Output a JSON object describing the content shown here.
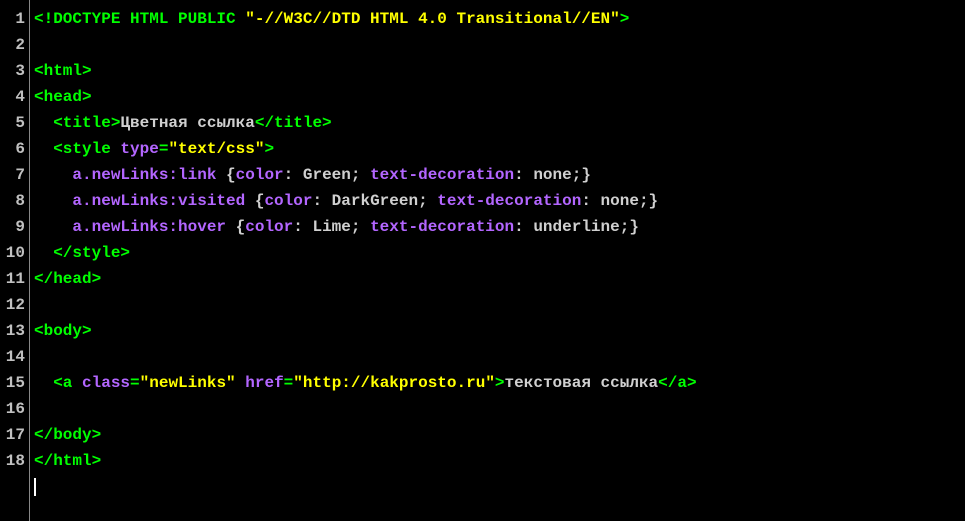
{
  "lines": [
    {
      "n": 1,
      "tokens": [
        {
          "t": "<!DOCTYPE HTML PUBLIC ",
          "c": "c-tag"
        },
        {
          "t": "\"-//W3C//DTD HTML 4.0 Transitional//EN\"",
          "c": "c-str"
        },
        {
          "t": ">",
          "c": "c-tag"
        }
      ]
    },
    {
      "n": 2,
      "tokens": []
    },
    {
      "n": 3,
      "tokens": [
        {
          "t": "<html>",
          "c": "c-tag"
        }
      ]
    },
    {
      "n": 4,
      "tokens": [
        {
          "t": "<head>",
          "c": "c-tag"
        }
      ]
    },
    {
      "n": 5,
      "tokens": [
        {
          "t": "  ",
          "c": "c-text"
        },
        {
          "t": "<title>",
          "c": "c-tag"
        },
        {
          "t": "Цветная ссылка",
          "c": "c-text"
        },
        {
          "t": "</title>",
          "c": "c-tag"
        }
      ]
    },
    {
      "n": 6,
      "tokens": [
        {
          "t": "  ",
          "c": "c-text"
        },
        {
          "t": "<style ",
          "c": "c-tag"
        },
        {
          "t": "type",
          "c": "c-attr"
        },
        {
          "t": "=",
          "c": "c-tag"
        },
        {
          "t": "\"text/css\"",
          "c": "c-str"
        },
        {
          "t": ">",
          "c": "c-tag"
        }
      ]
    },
    {
      "n": 7,
      "tokens": [
        {
          "t": "    ",
          "c": "c-text"
        },
        {
          "t": "a.newLinks:link ",
          "c": "c-attr"
        },
        {
          "t": "{",
          "c": "c-text"
        },
        {
          "t": "color",
          "c": "c-attr"
        },
        {
          "t": ": Green; ",
          "c": "c-text"
        },
        {
          "t": "text-decoration",
          "c": "c-attr"
        },
        {
          "t": ": none;",
          "c": "c-text"
        },
        {
          "t": "}",
          "c": "c-text"
        }
      ]
    },
    {
      "n": 8,
      "tokens": [
        {
          "t": "    ",
          "c": "c-text"
        },
        {
          "t": "a.newLinks:visited ",
          "c": "c-attr"
        },
        {
          "t": "{",
          "c": "c-text"
        },
        {
          "t": "color",
          "c": "c-attr"
        },
        {
          "t": ": DarkGreen; ",
          "c": "c-text"
        },
        {
          "t": "text-decoration",
          "c": "c-attr"
        },
        {
          "t": ": none;",
          "c": "c-text"
        },
        {
          "t": "}",
          "c": "c-text"
        }
      ]
    },
    {
      "n": 9,
      "tokens": [
        {
          "t": "    ",
          "c": "c-text"
        },
        {
          "t": "a.newLinks:hover ",
          "c": "c-attr"
        },
        {
          "t": "{",
          "c": "c-text"
        },
        {
          "t": "color",
          "c": "c-attr"
        },
        {
          "t": ": Lime; ",
          "c": "c-text"
        },
        {
          "t": "text-decoration",
          "c": "c-attr"
        },
        {
          "t": ": underline;",
          "c": "c-text"
        },
        {
          "t": "}",
          "c": "c-text"
        }
      ]
    },
    {
      "n": 10,
      "tokens": [
        {
          "t": "  ",
          "c": "c-text"
        },
        {
          "t": "</style>",
          "c": "c-tag"
        }
      ]
    },
    {
      "n": 11,
      "tokens": [
        {
          "t": "</head>",
          "c": "c-tag"
        }
      ]
    },
    {
      "n": 12,
      "tokens": []
    },
    {
      "n": 13,
      "tokens": [
        {
          "t": "<body>",
          "c": "c-tag"
        }
      ]
    },
    {
      "n": 14,
      "tokens": []
    },
    {
      "n": 15,
      "tokens": [
        {
          "t": "  ",
          "c": "c-text"
        },
        {
          "t": "<a ",
          "c": "c-tag"
        },
        {
          "t": "class",
          "c": "c-attr"
        },
        {
          "t": "=",
          "c": "c-tag"
        },
        {
          "t": "\"newLinks\"",
          "c": "c-str"
        },
        {
          "t": " ",
          "c": "c-tag"
        },
        {
          "t": "href",
          "c": "c-attr"
        },
        {
          "t": "=",
          "c": "c-tag"
        },
        {
          "t": "\"http://kakprosto.ru\"",
          "c": "c-str"
        },
        {
          "t": ">",
          "c": "c-tag"
        },
        {
          "t": "текстовая ссылка",
          "c": "c-text"
        },
        {
          "t": "</a>",
          "c": "c-tag"
        }
      ]
    },
    {
      "n": 16,
      "tokens": []
    },
    {
      "n": 17,
      "tokens": [
        {
          "t": "</body>",
          "c": "c-tag"
        }
      ]
    },
    {
      "n": 18,
      "tokens": [
        {
          "t": "</html>",
          "c": "c-tag"
        }
      ]
    }
  ]
}
